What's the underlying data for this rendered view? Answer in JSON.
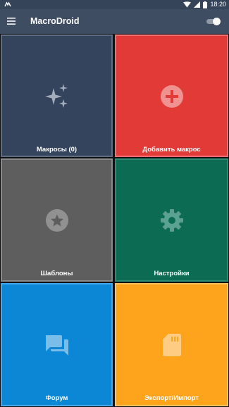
{
  "status_bar": {
    "time": "18:20",
    "icons": [
      "notification-icon",
      "wifi-icon",
      "signal-icon",
      "battery-icon"
    ]
  },
  "app_bar": {
    "title": "MacroDroid",
    "menu_icon": "menu-icon",
    "toggle_on": true
  },
  "tiles": [
    {
      "label": "Макросы (0)",
      "icon": "sparkle-icon",
      "color": "#34445d"
    },
    {
      "label": "Добавить макрос",
      "icon": "add-circle-icon",
      "color": "#e23a36"
    },
    {
      "label": "Шаблоны",
      "icon": "star-circle-icon",
      "color": "#5e5e5e"
    },
    {
      "label": "Настройки",
      "icon": "gear-icon",
      "color": "#0b6b53"
    },
    {
      "label": "Форум",
      "icon": "forum-icon",
      "color": "#0b87d6"
    },
    {
      "label": "Экспорт/Импорт",
      "icon": "sd-card-icon",
      "color": "#fea31c"
    }
  ]
}
